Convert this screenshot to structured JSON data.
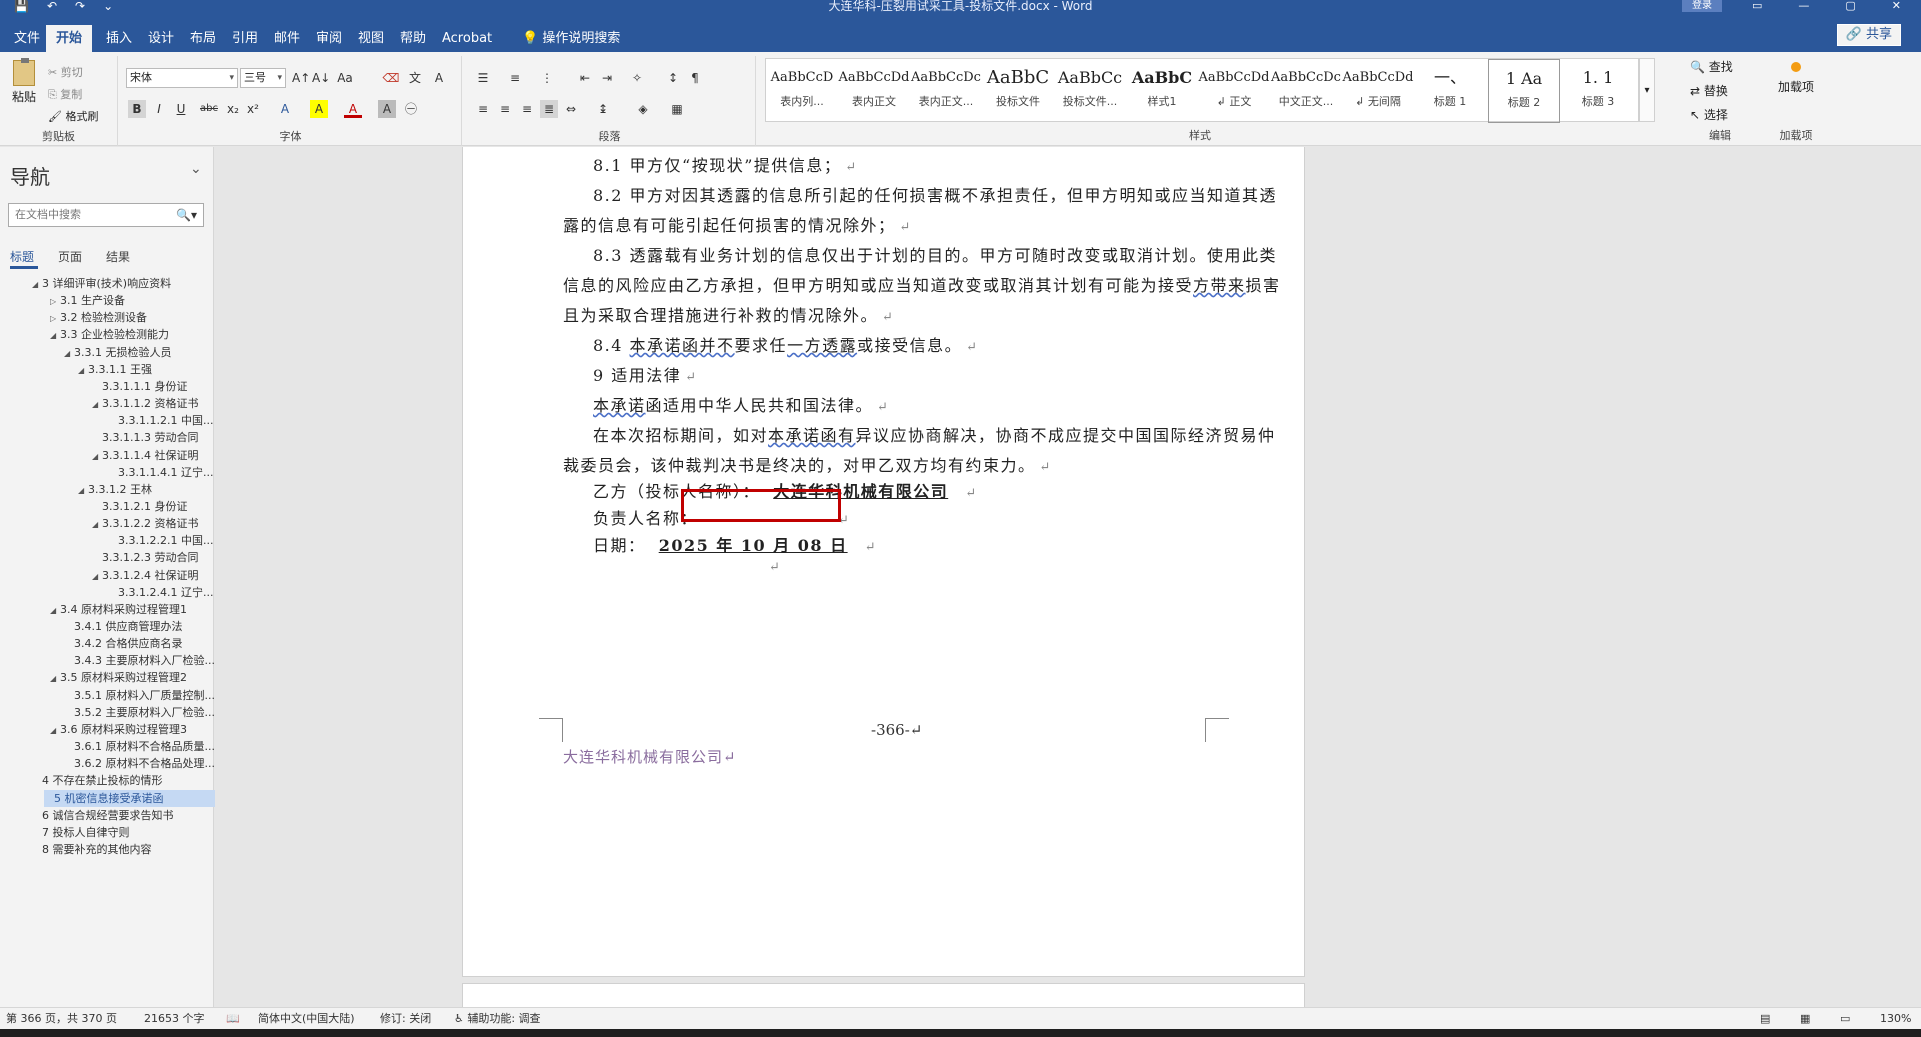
{
  "window": {
    "title": "大连华科-压裂用试采工具-投标文件.docx - Word",
    "login": "登录",
    "qat": [
      "💾",
      "↶",
      "↷",
      "⌄"
    ],
    "controls": [
      "▭",
      "—",
      "▢",
      "✕"
    ]
  },
  "tabs": [
    "文件",
    "开始",
    "插入",
    "设计",
    "布局",
    "引用",
    "邮件",
    "审阅",
    "视图",
    "帮助",
    "Acrobat",
    "操作说明搜索"
  ],
  "active_tab": "开始",
  "share": "🔗 共享",
  "ribbon": {
    "clipboard": {
      "paste": "粘贴",
      "cut": "剪切",
      "copy": "复制",
      "format_painter": "格式刷",
      "label": "剪贴板"
    },
    "font": {
      "name": "宋体",
      "size": "三号",
      "label": "字体",
      "buttons": [
        "B",
        "I",
        "U",
        "abc",
        "x₂",
        "x²",
        "A",
        "A",
        "A"
      ]
    },
    "paragraph": {
      "label": "段落"
    },
    "styles": {
      "label": "样式",
      "items": [
        {
          "preview": "AaBbCcD",
          "name": "表内列..."
        },
        {
          "preview": "AaBbCcDd",
          "name": "表内正文"
        },
        {
          "preview": "AaBbCcDc",
          "name": "表内正文..."
        },
        {
          "preview": "AaBbC",
          "name": "投标文件"
        },
        {
          "preview": "AaBbCc",
          "name": "投标文件..."
        },
        {
          "preview": "AaBbC",
          "name": "样式1"
        },
        {
          "preview": "AaBbCcDd",
          "name": "↲ 正文"
        },
        {
          "preview": "AaBbCcDc",
          "name": "中文正文..."
        },
        {
          "preview": "AaBbCcDd",
          "name": "↲ 无间隔"
        },
        {
          "preview": "一、",
          "name": "标题 1"
        },
        {
          "preview": "1  Aa",
          "name": "标题 2"
        },
        {
          "preview": "1. 1",
          "name": "标题 3"
        }
      ]
    },
    "editing": {
      "find": "查找",
      "replace": "替换",
      "select": "选择",
      "label": "编辑"
    },
    "addins": {
      "button": "加载项",
      "label": "加载项"
    }
  },
  "nav": {
    "title": "导航",
    "search_placeholder": "在文档中搜索",
    "tabs": [
      "标题",
      "页面",
      "结果"
    ],
    "items": [
      {
        "text": "3 详细评审(技术)响应资料",
        "level": 0,
        "tri": "◢"
      },
      {
        "text": "3.1 生产设备",
        "level": 1,
        "tri": "▷"
      },
      {
        "text": "3.2 检验检测设备",
        "level": 1,
        "tri": "▷"
      },
      {
        "text": "3.3 企业检验检测能力",
        "level": 1,
        "tri": "◢"
      },
      {
        "text": "3.3.1 无损检验人员",
        "level": 2,
        "tri": "◢"
      },
      {
        "text": "3.3.1.1 王强",
        "level": 3,
        "tri": "◢"
      },
      {
        "text": "3.3.1.1.1 身份证",
        "level": 4,
        "tri": ""
      },
      {
        "text": "3.3.1.1.2 资格证书",
        "level": 4,
        "tri": "◢"
      },
      {
        "text": "3.3.1.1.2.1 中国...",
        "level": 5,
        "tri": ""
      },
      {
        "text": "3.3.1.1.3 劳动合同",
        "level": 4,
        "tri": ""
      },
      {
        "text": "3.3.1.1.4 社保证明",
        "level": 4,
        "tri": "◢"
      },
      {
        "text": "3.3.1.1.4.1 辽宁...",
        "level": 5,
        "tri": ""
      },
      {
        "text": "3.3.1.2 王林",
        "level": 3,
        "tri": "◢"
      },
      {
        "text": "3.3.1.2.1 身份证",
        "level": 4,
        "tri": ""
      },
      {
        "text": "3.3.1.2.2 资格证书",
        "level": 4,
        "tri": "◢"
      },
      {
        "text": "3.3.1.2.2.1 中国...",
        "level": 5,
        "tri": ""
      },
      {
        "text": "3.3.1.2.3 劳动合同",
        "level": 4,
        "tri": ""
      },
      {
        "text": "3.3.1.2.4 社保证明",
        "level": 4,
        "tri": "◢"
      },
      {
        "text": "3.3.1.2.4.1 辽宁...",
        "level": 5,
        "tri": ""
      },
      {
        "text": "3.4 原材料采购过程管理1",
        "level": 1,
        "tri": "◢"
      },
      {
        "text": "3.4.1 供应商管理办法",
        "level": 2,
        "tri": ""
      },
      {
        "text": "3.4.2 合格供应商名录",
        "level": 2,
        "tri": ""
      },
      {
        "text": "3.4.3 主要原材料入厂检验...",
        "level": 2,
        "tri": ""
      },
      {
        "text": "3.5 原材料采购过程管理2",
        "level": 1,
        "tri": "◢"
      },
      {
        "text": "3.5.1 原材料入厂质量控制...",
        "level": 2,
        "tri": ""
      },
      {
        "text": "3.5.2 主要原材料入厂检验...",
        "level": 2,
        "tri": ""
      },
      {
        "text": "3.6 原材料采购过程管理3",
        "level": 1,
        "tri": "◢"
      },
      {
        "text": "3.6.1 原材料不合格品质量...",
        "level": 2,
        "tri": ""
      },
      {
        "text": "3.6.2 原材料不合格品处理...",
        "level": 2,
        "tri": ""
      },
      {
        "text": "4 不存在禁止投标的情形",
        "level": 0,
        "tri": ""
      },
      {
        "text": "5 机密信息接受承诺函",
        "level": 0,
        "tri": "",
        "selected": true
      },
      {
        "text": "6 诚信合规经营要求告知书",
        "level": 0,
        "tri": ""
      },
      {
        "text": "7 投标人自律守则",
        "level": 0,
        "tri": ""
      },
      {
        "text": "8 需要补充的其他内容",
        "level": 0,
        "tri": ""
      }
    ]
  },
  "document": {
    "p1": "8.1 甲方仅“按现状”提供信息；",
    "p2a": "8.2 甲方对因其透露的信息所引起的任何损害概不承担责任，但甲方明知或应当知道其透",
    "p2b": "露的信息有可能引起任何损害的情况除外；",
    "p3a": "8.3 透露载有业务计划的信息仅出于计划的目的。甲方可随时改变或取消计划。使用此类",
    "p3b_pre": "信息的风险应由乙方承担，但甲方明知或应当知道改变或取消其计划有可能为接受",
    "p3b_wave": "方带来",
    "p3b_post": "损害",
    "p3c": "且为采取合理措施进行补救的情况除外。",
    "p4_pre": "8.4 ",
    "p4_w1": "本承诺函并不",
    "p4_mid": "要求任",
    "p4_w2": "一方透露",
    "p4_post": "或接受信息。",
    "p5": "9 适用法律",
    "p6_w": "本承诺",
    "p6_post": "函适用中华人民共和国法律。",
    "p7_pre": "在本次招标期间，如对",
    "p7_w": "本承诺函有",
    "p7_post": "异议应协商解决，协商不成应提交中国国际经济贸易仲",
    "p7b": "裁委员会，该仲裁判决书是终决的，对甲乙双方均有约束力。",
    "p8_label": "乙方（投标人名称）：",
    "p8_value": "大连华科机械有限公司",
    "p9_label": "负责人名称：",
    "p10_label": "日期：",
    "p10_value": "2025 年 10 月 08 日",
    "para_mark": "↵",
    "page_number": "-366-",
    "footer_company": "大连华科机械有限公司"
  },
  "status": {
    "page": "第 366 页，共 370 页",
    "words": "21653 个字",
    "lang": "简体中文(中国大陆)",
    "track": "修订: 关闭",
    "accessibility": "辅助功能: 调查",
    "zoom": "130%"
  }
}
